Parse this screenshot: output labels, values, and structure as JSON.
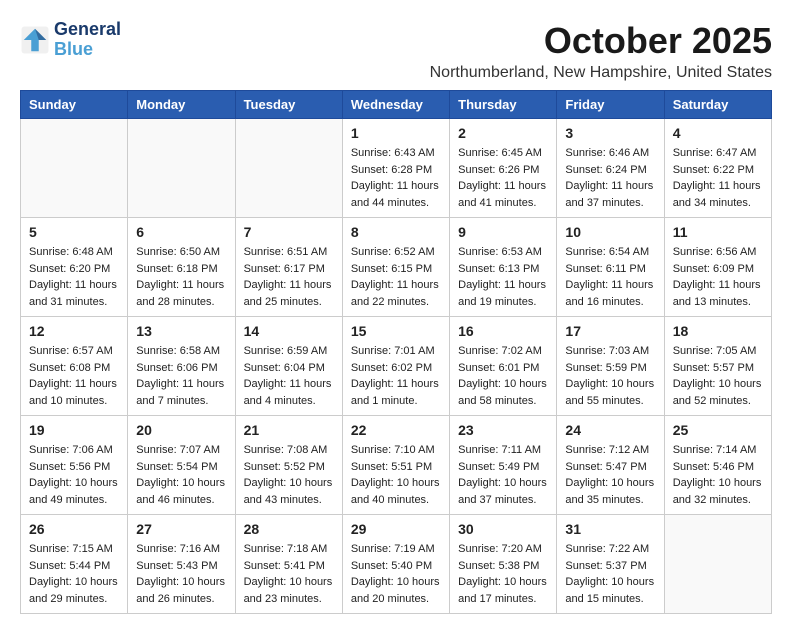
{
  "header": {
    "logo_line1": "General",
    "logo_line2": "Blue",
    "month": "October 2025",
    "location": "Northumberland, New Hampshire, United States"
  },
  "weekdays": [
    "Sunday",
    "Monday",
    "Tuesday",
    "Wednesday",
    "Thursday",
    "Friday",
    "Saturday"
  ],
  "weeks": [
    [
      {
        "day": "",
        "info": ""
      },
      {
        "day": "",
        "info": ""
      },
      {
        "day": "",
        "info": ""
      },
      {
        "day": "1",
        "info": "Sunrise: 6:43 AM\nSunset: 6:28 PM\nDaylight: 11 hours\nand 44 minutes."
      },
      {
        "day": "2",
        "info": "Sunrise: 6:45 AM\nSunset: 6:26 PM\nDaylight: 11 hours\nand 41 minutes."
      },
      {
        "day": "3",
        "info": "Sunrise: 6:46 AM\nSunset: 6:24 PM\nDaylight: 11 hours\nand 37 minutes."
      },
      {
        "day": "4",
        "info": "Sunrise: 6:47 AM\nSunset: 6:22 PM\nDaylight: 11 hours\nand 34 minutes."
      }
    ],
    [
      {
        "day": "5",
        "info": "Sunrise: 6:48 AM\nSunset: 6:20 PM\nDaylight: 11 hours\nand 31 minutes."
      },
      {
        "day": "6",
        "info": "Sunrise: 6:50 AM\nSunset: 6:18 PM\nDaylight: 11 hours\nand 28 minutes."
      },
      {
        "day": "7",
        "info": "Sunrise: 6:51 AM\nSunset: 6:17 PM\nDaylight: 11 hours\nand 25 minutes."
      },
      {
        "day": "8",
        "info": "Sunrise: 6:52 AM\nSunset: 6:15 PM\nDaylight: 11 hours\nand 22 minutes."
      },
      {
        "day": "9",
        "info": "Sunrise: 6:53 AM\nSunset: 6:13 PM\nDaylight: 11 hours\nand 19 minutes."
      },
      {
        "day": "10",
        "info": "Sunrise: 6:54 AM\nSunset: 6:11 PM\nDaylight: 11 hours\nand 16 minutes."
      },
      {
        "day": "11",
        "info": "Sunrise: 6:56 AM\nSunset: 6:09 PM\nDaylight: 11 hours\nand 13 minutes."
      }
    ],
    [
      {
        "day": "12",
        "info": "Sunrise: 6:57 AM\nSunset: 6:08 PM\nDaylight: 11 hours\nand 10 minutes."
      },
      {
        "day": "13",
        "info": "Sunrise: 6:58 AM\nSunset: 6:06 PM\nDaylight: 11 hours\nand 7 minutes."
      },
      {
        "day": "14",
        "info": "Sunrise: 6:59 AM\nSunset: 6:04 PM\nDaylight: 11 hours\nand 4 minutes."
      },
      {
        "day": "15",
        "info": "Sunrise: 7:01 AM\nSunset: 6:02 PM\nDaylight: 11 hours\nand 1 minute."
      },
      {
        "day": "16",
        "info": "Sunrise: 7:02 AM\nSunset: 6:01 PM\nDaylight: 10 hours\nand 58 minutes."
      },
      {
        "day": "17",
        "info": "Sunrise: 7:03 AM\nSunset: 5:59 PM\nDaylight: 10 hours\nand 55 minutes."
      },
      {
        "day": "18",
        "info": "Sunrise: 7:05 AM\nSunset: 5:57 PM\nDaylight: 10 hours\nand 52 minutes."
      }
    ],
    [
      {
        "day": "19",
        "info": "Sunrise: 7:06 AM\nSunset: 5:56 PM\nDaylight: 10 hours\nand 49 minutes."
      },
      {
        "day": "20",
        "info": "Sunrise: 7:07 AM\nSunset: 5:54 PM\nDaylight: 10 hours\nand 46 minutes."
      },
      {
        "day": "21",
        "info": "Sunrise: 7:08 AM\nSunset: 5:52 PM\nDaylight: 10 hours\nand 43 minutes."
      },
      {
        "day": "22",
        "info": "Sunrise: 7:10 AM\nSunset: 5:51 PM\nDaylight: 10 hours\nand 40 minutes."
      },
      {
        "day": "23",
        "info": "Sunrise: 7:11 AM\nSunset: 5:49 PM\nDaylight: 10 hours\nand 37 minutes."
      },
      {
        "day": "24",
        "info": "Sunrise: 7:12 AM\nSunset: 5:47 PM\nDaylight: 10 hours\nand 35 minutes."
      },
      {
        "day": "25",
        "info": "Sunrise: 7:14 AM\nSunset: 5:46 PM\nDaylight: 10 hours\nand 32 minutes."
      }
    ],
    [
      {
        "day": "26",
        "info": "Sunrise: 7:15 AM\nSunset: 5:44 PM\nDaylight: 10 hours\nand 29 minutes."
      },
      {
        "day": "27",
        "info": "Sunrise: 7:16 AM\nSunset: 5:43 PM\nDaylight: 10 hours\nand 26 minutes."
      },
      {
        "day": "28",
        "info": "Sunrise: 7:18 AM\nSunset: 5:41 PM\nDaylight: 10 hours\nand 23 minutes."
      },
      {
        "day": "29",
        "info": "Sunrise: 7:19 AM\nSunset: 5:40 PM\nDaylight: 10 hours\nand 20 minutes."
      },
      {
        "day": "30",
        "info": "Sunrise: 7:20 AM\nSunset: 5:38 PM\nDaylight: 10 hours\nand 17 minutes."
      },
      {
        "day": "31",
        "info": "Sunrise: 7:22 AM\nSunset: 5:37 PM\nDaylight: 10 hours\nand 15 minutes."
      },
      {
        "day": "",
        "info": ""
      }
    ]
  ]
}
